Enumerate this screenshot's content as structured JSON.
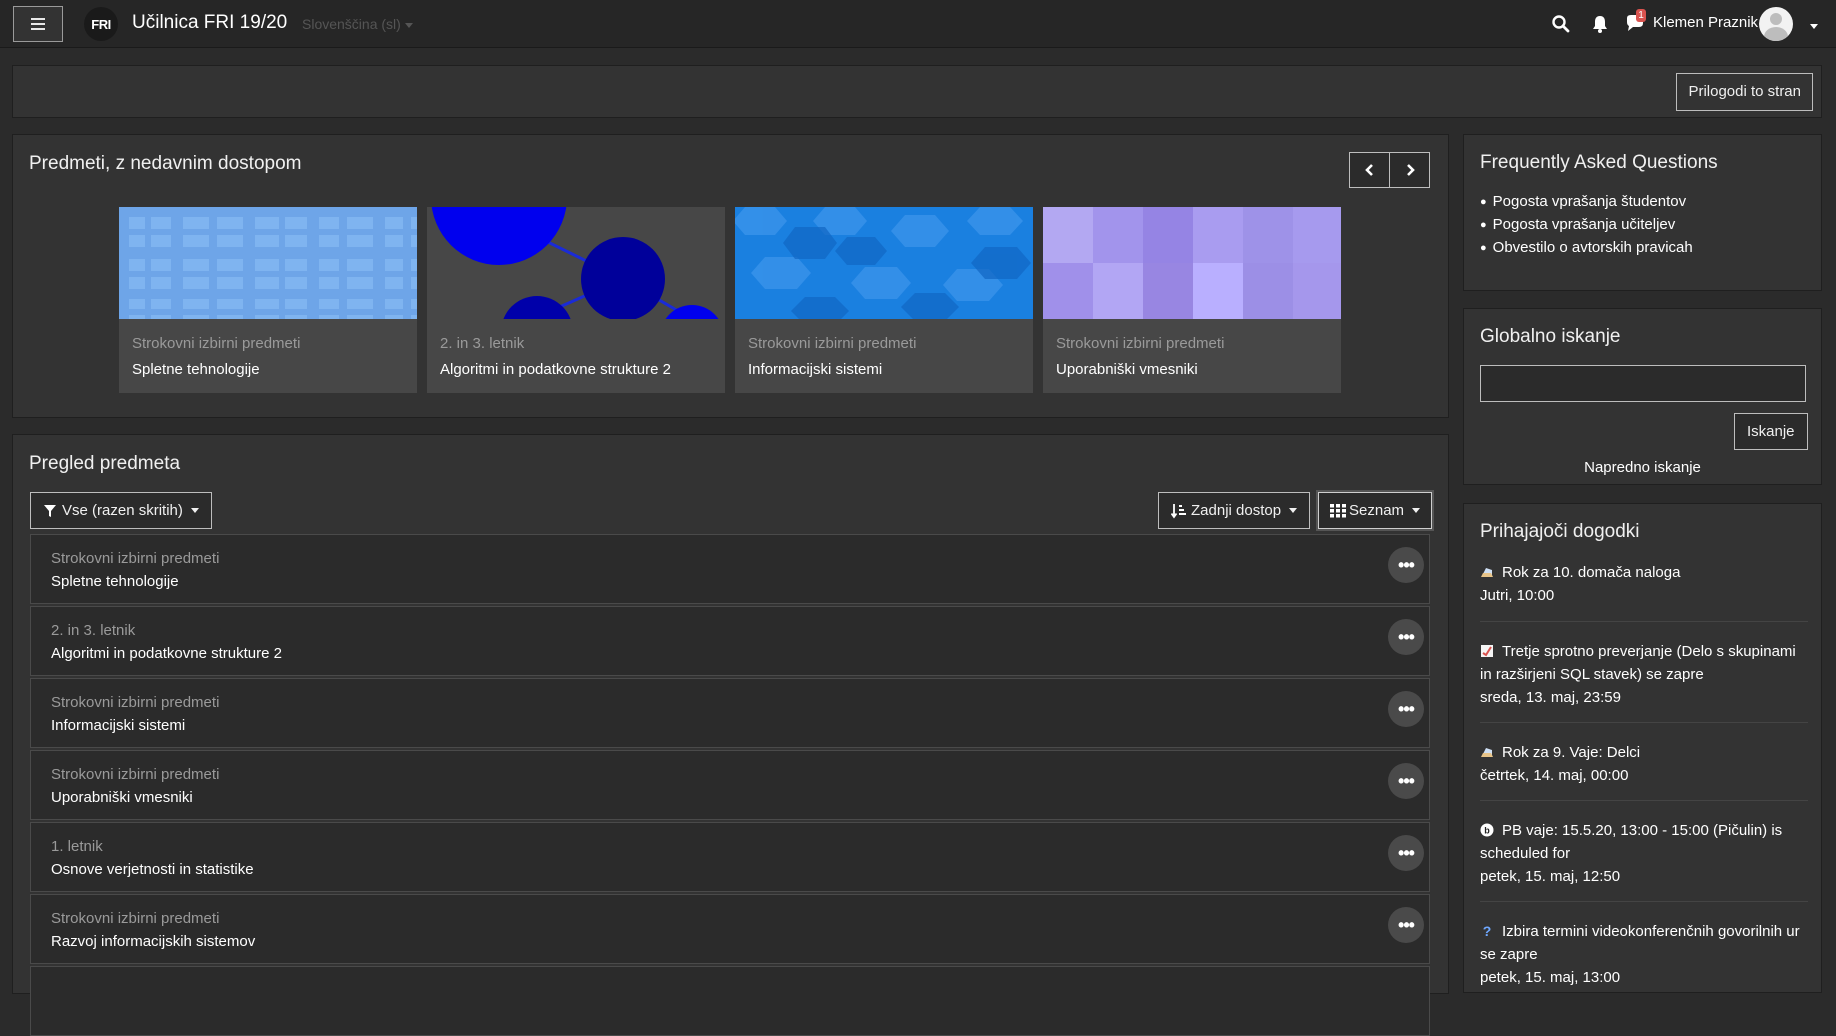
{
  "navbar": {
    "logo_text": "FRI",
    "site_name": "Učilnica FRI 19/20",
    "language": "Slovenščina (sl)",
    "notification_badge": "1",
    "user_name": "Klemen Praznik"
  },
  "page_header": {
    "customise_label": "Prilogodi to stran"
  },
  "recent": {
    "title": "Predmeti, z nedavnim dostopom",
    "courses": [
      {
        "category": "Strokovni izbirni predmeti",
        "name": "Spletne tehnologije"
      },
      {
        "category": "2. in 3. letnik",
        "name": "Algoritmi in podatkovne strukture 2"
      },
      {
        "category": "Strokovni izbirni predmeti",
        "name": "Informacijski sistemi"
      },
      {
        "category": "Strokovni izbirni predmeti",
        "name": "Uporabniški vmesniki"
      }
    ]
  },
  "overview": {
    "title": "Pregled predmeta",
    "filter_label": "Vse (razen skritih)",
    "sort_label": "Zadnji dostop",
    "view_label": "Seznam",
    "courses": [
      {
        "category": "Strokovni izbirni predmeti",
        "name": "Spletne tehnologije"
      },
      {
        "category": "2. in 3. letnik",
        "name": "Algoritmi in podatkovne strukture 2"
      },
      {
        "category": "Strokovni izbirni predmeti",
        "name": "Informacijski sistemi"
      },
      {
        "category": "Strokovni izbirni predmeti",
        "name": "Uporabniški vmesniki"
      },
      {
        "category": "1. letnik",
        "name": "Osnove verjetnosti in statistike"
      },
      {
        "category": "Strokovni izbirni predmeti",
        "name": "Razvoj informacijskih sistemov"
      }
    ]
  },
  "faq": {
    "title": "Frequently Asked Questions",
    "items": [
      "Pogosta vprašanja študentov",
      "Pogosta vprašanja učiteljev",
      "Obvestilo o avtorskih pravicah"
    ]
  },
  "search": {
    "title": "Globalno iskanje",
    "button_label": "Iskanje",
    "advanced_label": "Napredno iskanje"
  },
  "events": {
    "title": "Prihajajoči dogodki",
    "items": [
      {
        "icon": "assignment-icon",
        "title": "Rok za 10. domača naloga",
        "time": "Jutri, 10:00"
      },
      {
        "icon": "quiz-icon",
        "title": "Tretje sprotno preverjanje (Delo s skupinami in razširjeni SQL stavek) se zapre",
        "time": "sreda, 13. maj, 23:59"
      },
      {
        "icon": "assignment-icon",
        "title": "Rok za 9. Vaje: Delci",
        "time": "četrtek, 14. maj, 00:00"
      },
      {
        "icon": "bigbluebutton-icon",
        "title": "PB vaje: 15.5.20, 13:00 - 15:00 (Pičulin) is scheduled for",
        "time": "petek, 15. maj, 12:50"
      },
      {
        "icon": "question-icon",
        "title": "Izbira termini videokonferenčnih govorilnih ur se zapre",
        "time": "petek, 15. maj, 13:00"
      }
    ]
  },
  "colors": {
    "background": "#2b2b2b",
    "card": "#333333",
    "navbar": "#262626",
    "badge": "#d9534f"
  }
}
